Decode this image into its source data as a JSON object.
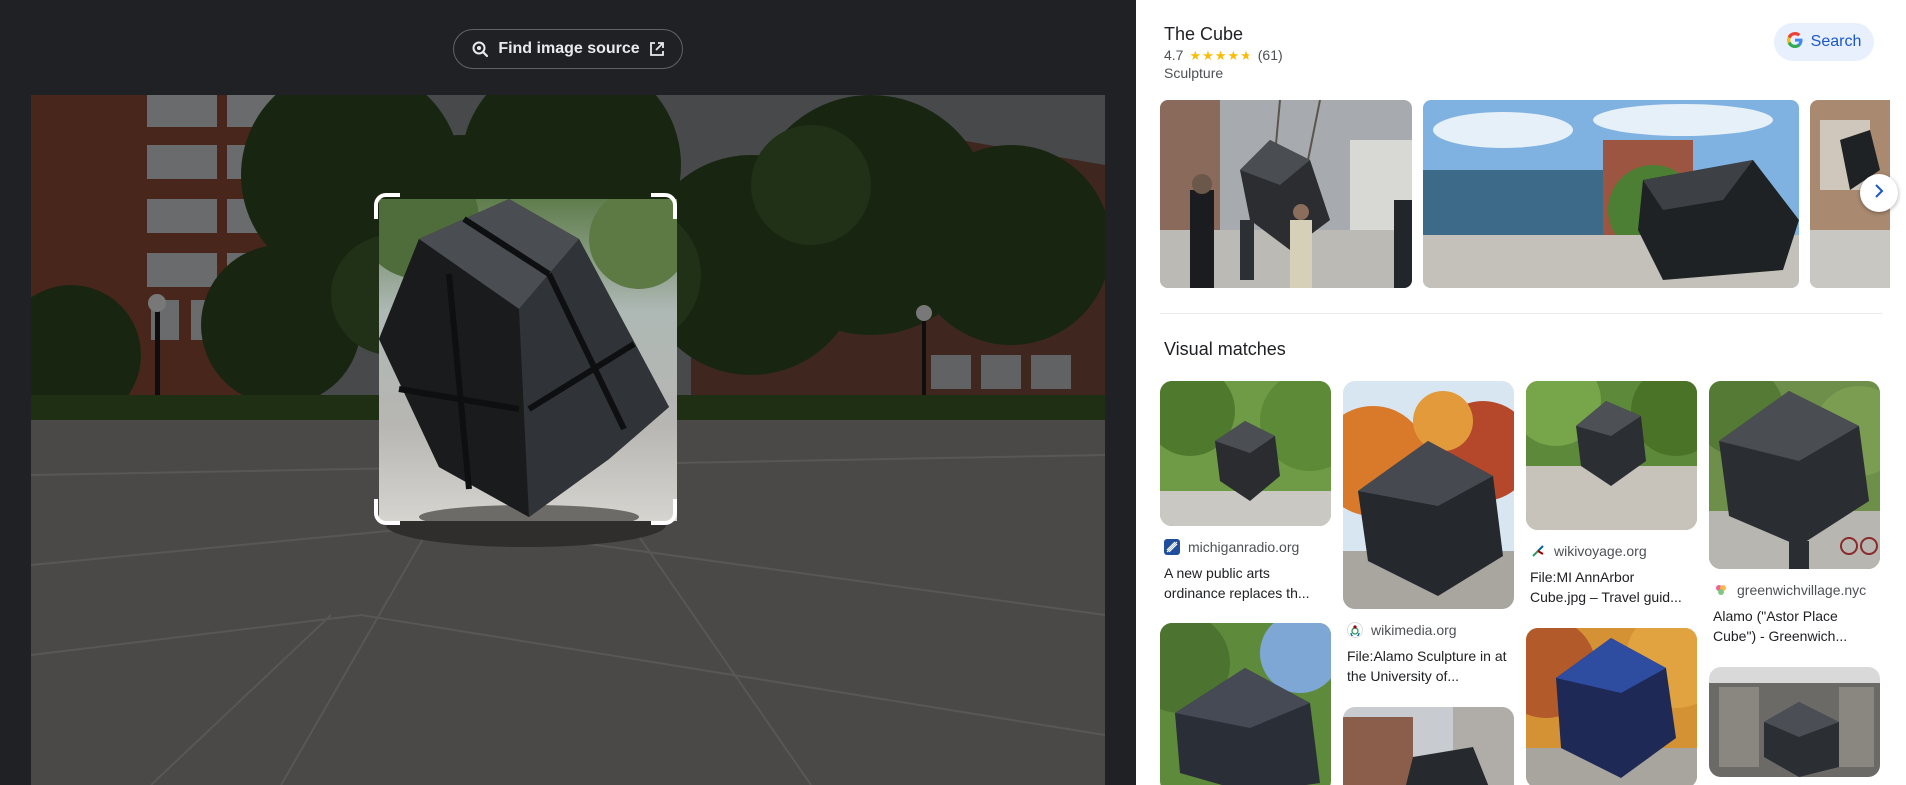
{
  "toolbar": {
    "find_source_label": "Find image source"
  },
  "knowledge_panel": {
    "title": "The Cube",
    "rating": "4.7",
    "review_count": "(61)",
    "category": "Sculpture",
    "search_label": "Search",
    "star_rating_value": 4.7
  },
  "visual_matches": {
    "heading": "Visual matches",
    "items": [
      {
        "source": "michiganradio.org",
        "title": "A new public arts ordinance replaces th..."
      },
      {
        "source": "wikimedia.org",
        "title": "File:Alamo Sculpture in at the University of..."
      },
      {
        "source": "wikivoyage.org",
        "title": "File:MI AnnArbor Cube.jpg – Travel guid..."
      },
      {
        "source": "greenwichvillage.nyc",
        "title": "Alamo (\"Astor Place Cube\") - Greenwich..."
      }
    ]
  },
  "colors": {
    "left_background": "#202124",
    "accent_blue": "#1a57c8",
    "star_yellow": "#fbbc04"
  },
  "icons": [
    "lens-search-icon",
    "external-link-icon",
    "google-g-icon",
    "chevron-right-icon"
  ]
}
